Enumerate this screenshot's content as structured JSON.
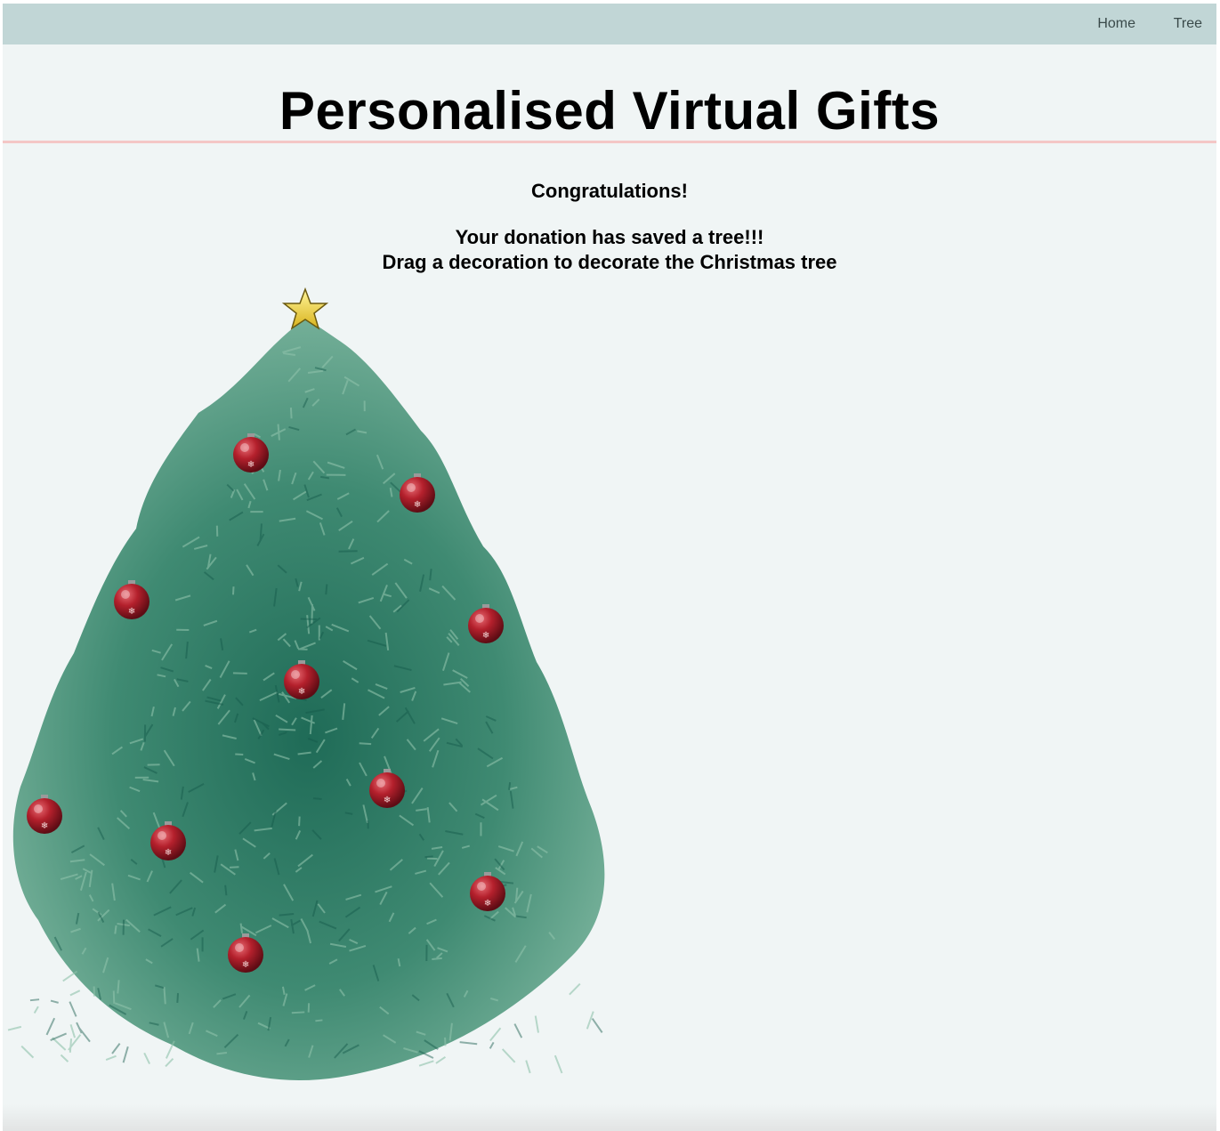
{
  "nav": {
    "home_label": "Home",
    "tree_label": "Tree"
  },
  "header": {
    "title": "Personalised Virtual Gifts"
  },
  "message": {
    "line1": "Congratulations!",
    "line2": "Your donation has saved a tree!!!",
    "line3": "Drag a decoration to decorate the Christmas tree"
  },
  "tree": {
    "decoration_count": 10,
    "star_color": "#f2d43a",
    "ornament_color": "#b4202c",
    "foliage_color": "#5e9e86"
  },
  "colors": {
    "navbar": "#c1d6d6",
    "background": "#f0f5f5",
    "divider": "#f4c7c6"
  }
}
